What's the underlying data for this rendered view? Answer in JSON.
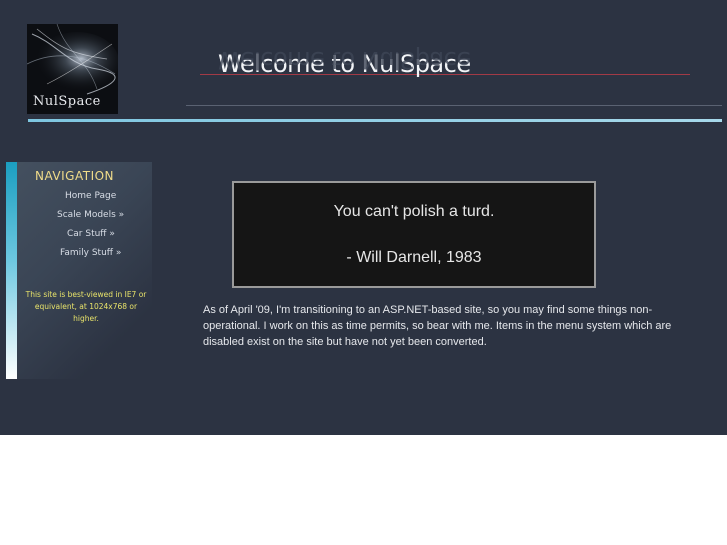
{
  "logo": {
    "text": "NulSpace",
    "icon": "nebula-swirl-image"
  },
  "header": {
    "title": "Welcome to NulSpace"
  },
  "nav": {
    "heading": "NAVIGATION",
    "items": [
      {
        "label": "Home Page"
      },
      {
        "label": "Scale Models »"
      },
      {
        "label": "Car Stuff »"
      },
      {
        "label": "Family Stuff »"
      }
    ],
    "note": "This site is best-viewed in IE7 or equivalent, at 1024x768 or higher."
  },
  "quote": {
    "text": "You can't polish a turd.",
    "attribution": "- Will Darnell, 1983"
  },
  "notice": "As of April '09, I'm transitioning to an ASP.NET-based site, so you may find some things non-operational. I work on this as time permits, so bear with me. Items in the menu system which are disabled exist on the site but have not yet been converted.",
  "colors": {
    "background": "#2c3342",
    "accent_blue": "#7ec6e0",
    "nav_heading": "#f0dc8a",
    "note_yellow": "#e8e36a",
    "title_line_red": "#a23a46"
  }
}
